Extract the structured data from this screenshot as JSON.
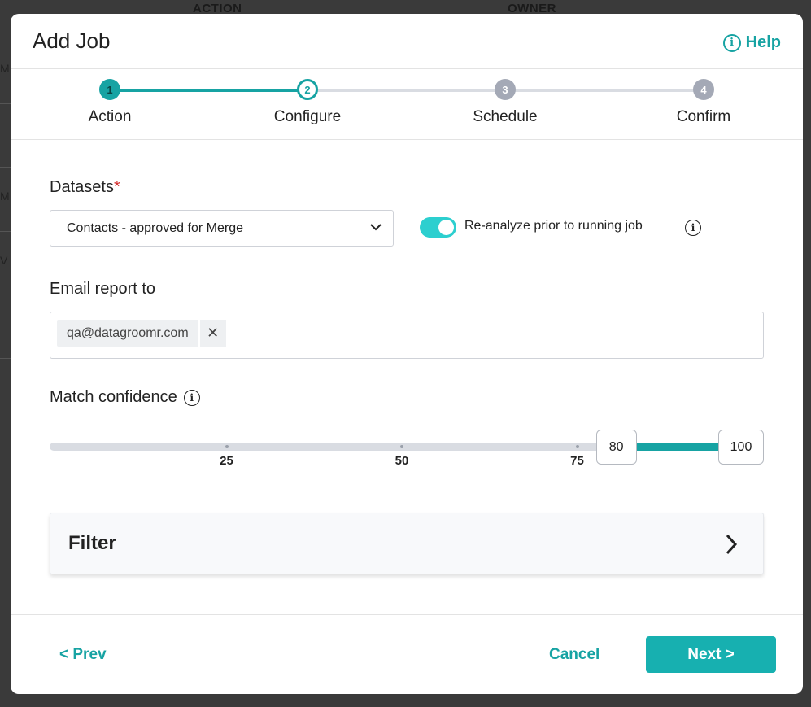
{
  "background": {
    "col1": "ACTION",
    "col2": "OWNER",
    "row_letters": [
      "M",
      "M",
      "V"
    ]
  },
  "modal": {
    "title": "Add Job",
    "help_label": "Help",
    "help_icon": "info-icon"
  },
  "stepper": {
    "steps": [
      {
        "number": "1",
        "label": "Action",
        "state": "done"
      },
      {
        "number": "2",
        "label": "Configure",
        "state": "active"
      },
      {
        "number": "3",
        "label": "Schedule",
        "state": "todo"
      },
      {
        "number": "4",
        "label": "Confirm",
        "state": "todo"
      }
    ]
  },
  "datasets": {
    "label": "Datasets",
    "required_mark": "*",
    "selected": "Contacts - approved for Merge"
  },
  "reanalyze": {
    "label": "Re-analyze prior to running job",
    "enabled": true
  },
  "email": {
    "label": "Email report to",
    "recipients": [
      "qa@datagroomr.com"
    ]
  },
  "match_confidence": {
    "label": "Match confidence",
    "min": 0,
    "max": 100,
    "ticks": [
      "25",
      "50",
      "75"
    ],
    "low_value": "80",
    "high_value": "100"
  },
  "filter": {
    "label": "Filter"
  },
  "footer": {
    "prev_label": "< Prev",
    "cancel_label": "Cancel",
    "next_label": "Next >"
  },
  "colors": {
    "accent": "#17a3a3",
    "toggle_on": "#2ccfcf",
    "step_todo": "#a4a9b6",
    "required": "#d32f2f"
  }
}
